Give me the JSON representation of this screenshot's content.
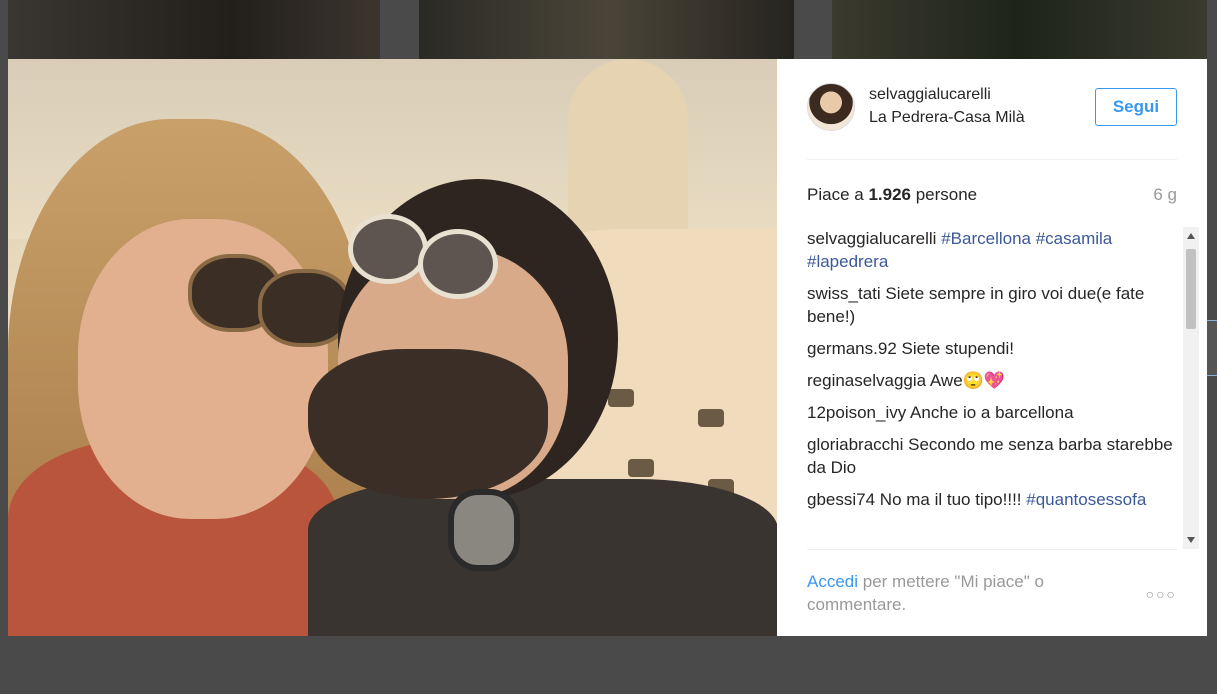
{
  "post": {
    "username": "selvaggialucarelli",
    "location": "La Pedrera-Casa Milà",
    "follow_label": "Segui",
    "likes_prefix": "Piace a ",
    "likes_count": "1.926",
    "likes_suffix": " persone",
    "time_ago": "6 g"
  },
  "comments": [
    {
      "user": "selvaggialucarelli",
      "text": "",
      "tags": [
        "#Barcellona",
        "#casamila",
        "#lapedrera"
      ]
    },
    {
      "user": "swiss_tati",
      "text": "Siete sempre in giro voi due(e fate bene!)"
    },
    {
      "user": "germans.92",
      "text": "Siete stupendi!"
    },
    {
      "user": "reginaselvaggia",
      "text": "Awe🙄💖"
    },
    {
      "user": "12poison_ivy",
      "text": "Anche io a barcellona"
    },
    {
      "user": "gloriabracchi",
      "text": "Secondo me senza barba starebbe da Dio"
    },
    {
      "user": "gbessi74",
      "text": "No ma il tuo tipo!!!!",
      "tags": [
        "#quantosessofa"
      ]
    }
  ],
  "footer": {
    "login_label": "Accedi",
    "login_suffix": " per mettere \"Mi piace\" o commentare.",
    "more_label": "○○○"
  },
  "colors": {
    "link": "#3897f0",
    "hashtag": "#3b5998",
    "text": "#262626",
    "muted": "#999999",
    "overlay": "#4a4a4a"
  },
  "icons": [
    "avatar",
    "more-options-icon",
    "scroll-up-arrow-icon",
    "scroll-down-arrow-icon"
  ]
}
